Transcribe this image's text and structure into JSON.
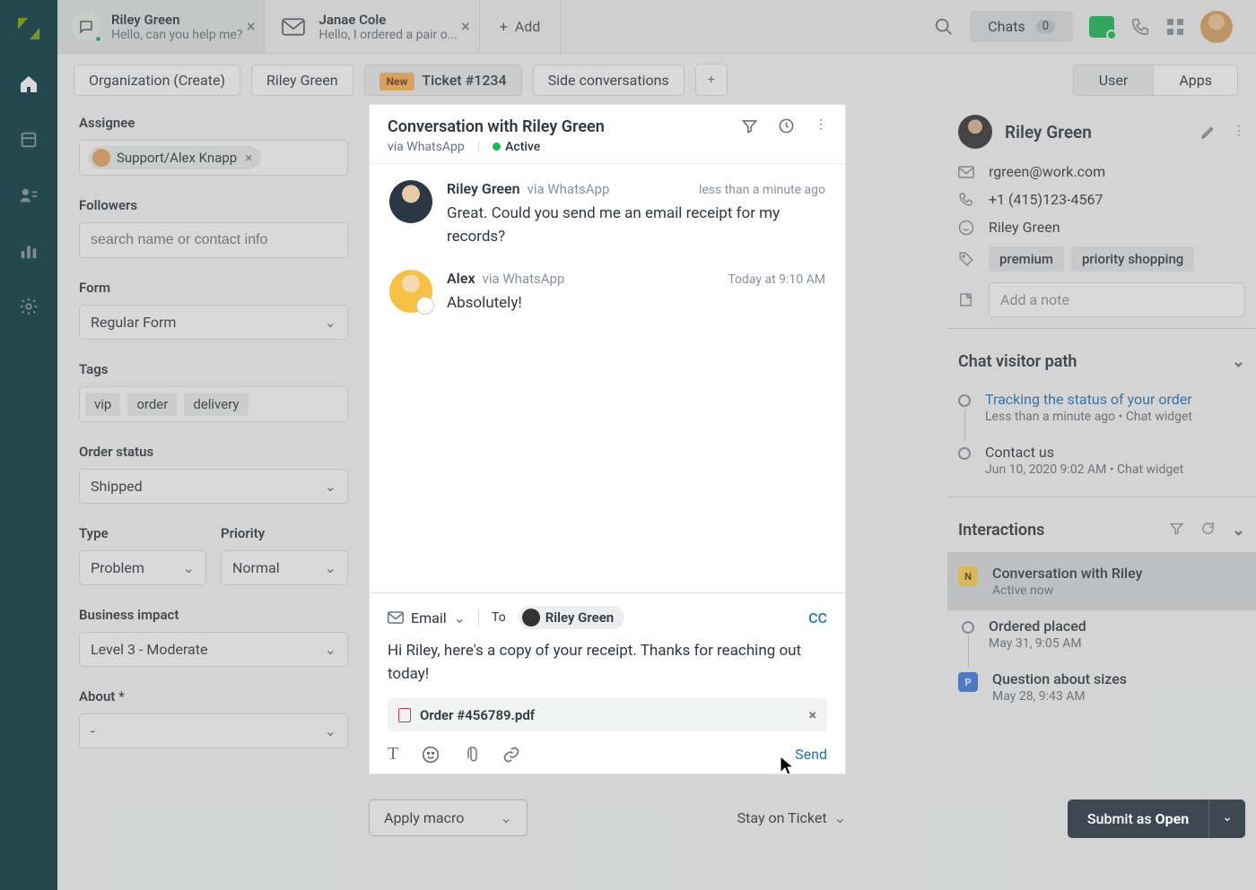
{
  "tabs": [
    {
      "title": "Riley Green",
      "sub": "Hello, can you help me?"
    },
    {
      "title": "Janae Cole",
      "sub": "Hello, I ordered a pair o..."
    }
  ],
  "add_tab": "Add",
  "chats": {
    "label": "Chats",
    "count": "0"
  },
  "breadcrumbs": {
    "org": "Organization (Create)",
    "person": "Riley Green",
    "new_badge": "New",
    "ticket": "Ticket #1234",
    "side": "Side conversations",
    "seg_user": "User",
    "seg_apps": "Apps"
  },
  "left": {
    "assignee_label": "Assignee",
    "assignee_value": "Support/Alex Knapp",
    "followers_label": "Followers",
    "followers_placeholder": "search name or contact info",
    "form_label": "Form",
    "form_value": "Regular Form",
    "tags_label": "Tags",
    "tags": [
      "vip",
      "order",
      "delivery"
    ],
    "order_status_label": "Order status",
    "order_status_value": "Shipped",
    "type_label": "Type",
    "type_value": "Problem",
    "priority_label": "Priority",
    "priority_value": "Normal",
    "impact_label": "Business impact",
    "impact_value": "Level 3 - Moderate",
    "about_label": "About *",
    "about_value": "-"
  },
  "convo": {
    "title": "Conversation with Riley Green",
    "via": "via WhatsApp",
    "status": "Active",
    "messages": [
      {
        "name": "Riley Green",
        "via": "via WhatsApp",
        "time": "less than a minute ago",
        "text": "Great. Could you send me an email receipt for my records?"
      },
      {
        "name": "Alex",
        "via": "via WhatsApp",
        "time": "Today at 9:10 AM",
        "text": "Absolutely!"
      }
    ],
    "composer": {
      "channel": "Email",
      "to_label": "To",
      "to_name": "Riley Green",
      "cc": "CC",
      "body": "Hi Riley, here's a copy of your receipt. Thanks for reaching out today!",
      "attachment": "Order #456789.pdf",
      "send": "Send"
    }
  },
  "right": {
    "name": "Riley Green",
    "email": "rgreen@work.com",
    "phone": "+1 (415)123-4567",
    "whatsapp": "Riley Green",
    "tags": [
      "premium",
      "priority shopping"
    ],
    "note_placeholder": "Add a note",
    "visitor_head": "Chat visitor path",
    "visitor": [
      {
        "title": "Tracking the status of your order",
        "meta": "Less than a minute ago • Chat widget",
        "link": true
      },
      {
        "title": "Contact us",
        "meta": "Jun 10, 2020 9:02 AM • Chat widget",
        "link": false
      }
    ],
    "interactions_head": "Interactions",
    "interactions": [
      {
        "badge": "N",
        "badgeClass": "n",
        "title": "Conversation with Riley",
        "meta": "Active now",
        "active": true
      },
      {
        "badge": "",
        "badgeClass": "dot",
        "title": "Ordered placed",
        "meta": "May 31, 9:05 AM"
      },
      {
        "badge": "P",
        "badgeClass": "p",
        "title": "Question about sizes",
        "meta": "May 28, 9:43 AM"
      }
    ]
  },
  "bottom": {
    "macro": "Apply macro",
    "stay": "Stay on Ticket",
    "submit_prefix": "Submit as ",
    "submit_state": "Open"
  }
}
